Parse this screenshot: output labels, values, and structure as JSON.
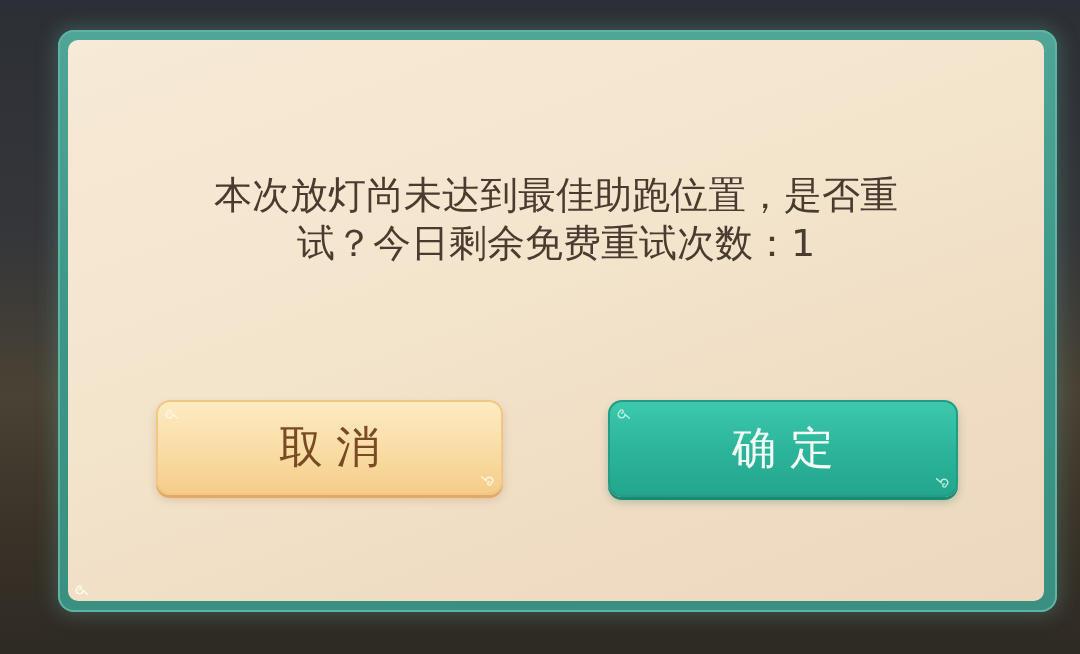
{
  "dialog": {
    "message": "本次放灯尚未达到最佳助跑位置，是否重试？今日剩余免费重试次数：1"
  },
  "buttons": [
    {
      "label": "取消",
      "kind": "secondary"
    },
    {
      "label": "确定",
      "kind": "primary"
    }
  ]
}
